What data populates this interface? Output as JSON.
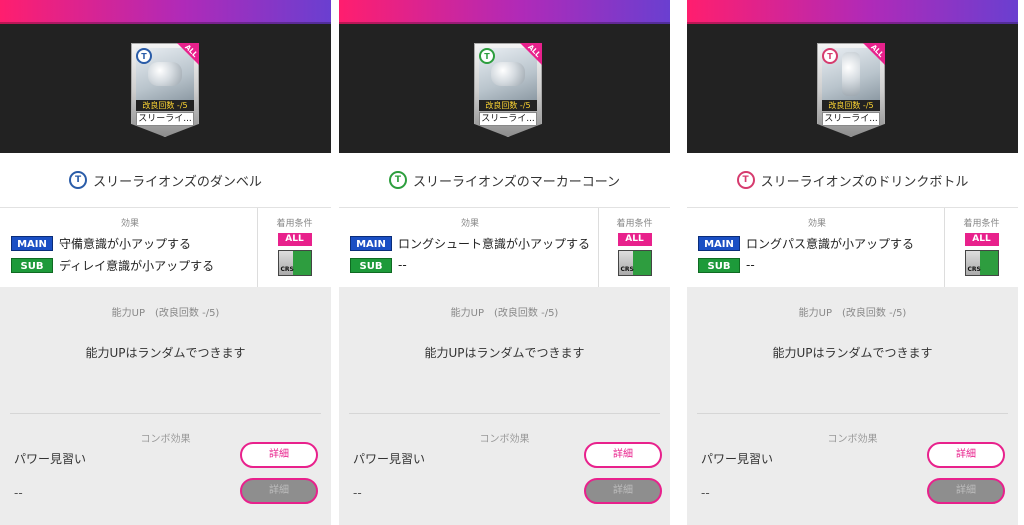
{
  "panels": [
    {
      "card": {
        "improve": "改良回数 -/5",
        "name": "スリーライ...",
        "all": "ALL",
        "icon": "t-shirt-icon"
      },
      "title": "スリーライオンズのダンベル",
      "effect_label": "効果",
      "main_tag": "MAIN",
      "main_text": "守備意識が小アップする",
      "sub_tag": "SUB",
      "sub_text": "ディレイ意識が小アップする",
      "cond_label": "着用条件",
      "cond_all": "ALL",
      "cond_crs": "CRS",
      "ability_title": "能力UP　(改良回数 -/5)",
      "ability_text": "能力UPはランダムでつきます",
      "combo_title": "コンボ効果",
      "combo_name": "パワー見習い",
      "combo_empty": "--",
      "btn_detail": "詳細",
      "btn_detail_disabled": "詳細"
    },
    {
      "card": {
        "improve": "改良回数 -/5",
        "name": "スリーライ...",
        "all": "ALL",
        "icon": "t-shirt-icon"
      },
      "title": "スリーライオンズのマーカーコーン",
      "effect_label": "効果",
      "main_tag": "MAIN",
      "main_text": "ロングシュート意識が小アップする",
      "sub_tag": "SUB",
      "sub_text": "--",
      "cond_label": "着用条件",
      "cond_all": "ALL",
      "cond_crs": "CRS",
      "ability_title": "能力UP　(改良回数 -/5)",
      "ability_text": "能力UPはランダムでつきます",
      "combo_title": "コンボ効果",
      "combo_name": "パワー見習い",
      "combo_empty": "--",
      "btn_detail": "詳細",
      "btn_detail_disabled": "詳細"
    },
    {
      "card": {
        "improve": "改良回数 -/5",
        "name": "スリーライ...",
        "all": "ALL",
        "icon": "t-shirt-icon"
      },
      "title": "スリーライオンズのドリンクボトル",
      "effect_label": "効果",
      "main_tag": "MAIN",
      "main_text": "ロングパス意識が小アップする",
      "sub_tag": "SUB",
      "sub_text": "--",
      "cond_label": "着用条件",
      "cond_all": "ALL",
      "cond_crs": "CRS",
      "ability_title": "能力UP　(改良回数 -/5)",
      "ability_text": "能力UPはランダムでつきます",
      "combo_title": "コンボ効果",
      "combo_name": "パワー見習い",
      "combo_empty": "--",
      "btn_detail": "詳細",
      "btn_detail_disabled": "詳細"
    }
  ],
  "colors": {
    "accent_pink": "#e8218c",
    "main_blue": "#1a4fc4",
    "sub_green": "#1d9a3a",
    "icon_blue": "#2a5ca8",
    "icon_green": "#2d9e3e",
    "icon_pink": "#d63b6e"
  }
}
